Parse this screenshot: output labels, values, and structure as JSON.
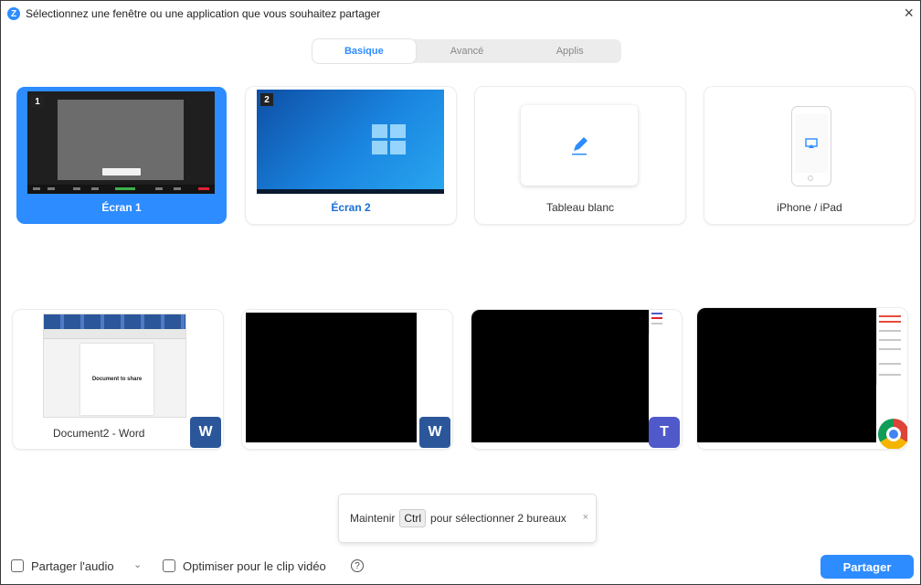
{
  "window": {
    "title": "Sélectionnez une fenêtre ou une application que vous souhaitez partager",
    "logo_letter": "Z",
    "close_glyph": "×"
  },
  "tabs": [
    {
      "label": "Basique",
      "active": true
    },
    {
      "label": "Avancé",
      "active": false
    },
    {
      "label": "Applis",
      "active": false
    }
  ],
  "screens": [
    {
      "label": "Écran 1",
      "number": "1",
      "selected": true
    },
    {
      "label": "Écran 2",
      "number": "2",
      "selected": false
    },
    {
      "label": "Tableau blanc",
      "icon": "pencil-icon"
    },
    {
      "label": "iPhone / iPad",
      "icon": "airplay-icon"
    }
  ],
  "windows": [
    {
      "label": "Document2 - Word",
      "preview_text": "Document to share",
      "app_icon": "word-icon",
      "app_letter": "W"
    },
    {
      "label": "",
      "app_icon": "word-icon",
      "app_letter": "W"
    },
    {
      "label": "",
      "app_icon": "teams-icon",
      "app_letter": "T"
    },
    {
      "label": "",
      "app_icon": "chrome-icon"
    }
  ],
  "hint": {
    "prefix": "Maintenir",
    "key": "Ctrl",
    "suffix": "pour sélectionner 2 bureaux",
    "close_glyph": "×"
  },
  "footer": {
    "share_audio_label": "Partager l'audio",
    "audio_caret": "⌄",
    "optimize_label": "Optimiser pour le clip vidéo",
    "help_glyph": "?",
    "share_button": "Partager"
  },
  "colors": {
    "accent": "#2d8cff",
    "word": "#2b579a",
    "teams": "#5059c9"
  }
}
